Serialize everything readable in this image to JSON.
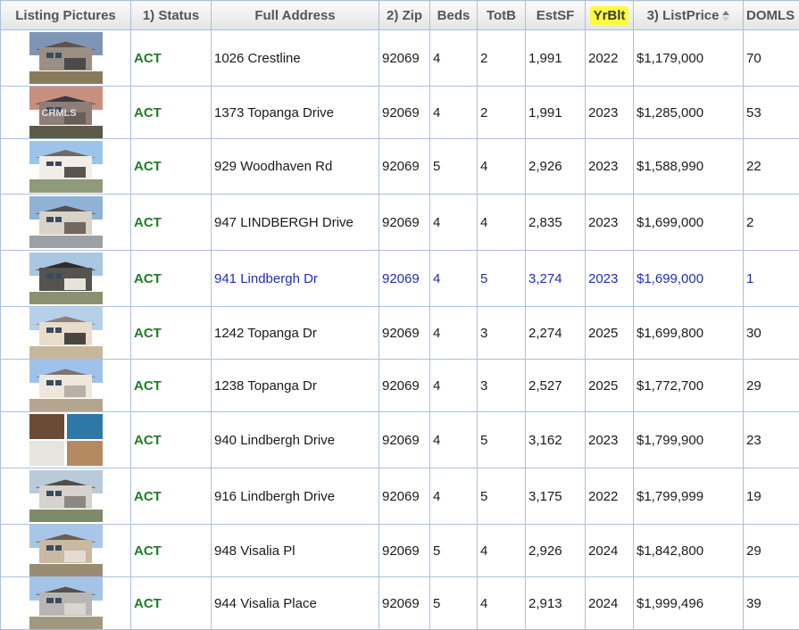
{
  "headers": {
    "pictures": "Listing Pictures",
    "status": "1) Status",
    "address": "Full Address",
    "zip": "2) Zip",
    "beds": "Beds",
    "totb": "TotB",
    "estsf": "EstSF",
    "yrblt": "YrBlt",
    "listprice": "3) ListPrice",
    "doml": "DOMLS"
  },
  "highlight_color": "#fffb3a",
  "status_color": "#1e7d24",
  "selected_row_color": "#1f2fb0",
  "rows": [
    {
      "status": "ACT",
      "address": "1026 Crestline",
      "zip": "92069",
      "beds": "4",
      "totb": "2",
      "estsf": "1,991",
      "yrblt": "2022",
      "price": "$1,179,000",
      "doml": "70",
      "photo": "aerial-neighborhood-photo"
    },
    {
      "status": "ACT",
      "address": "1373  Topanga Drive",
      "zip": "92069",
      "beds": "4",
      "totb": "2",
      "estsf": "1,991",
      "yrblt": "2023",
      "price": "$1,285,000",
      "doml": "53",
      "photo": "dusk-house-photo",
      "watermark": "CRMLS"
    },
    {
      "status": "ACT",
      "address": "929 Woodhaven Rd",
      "zip": "92069",
      "beds": "5",
      "totb": "4",
      "estsf": "2,926",
      "yrblt": "2023",
      "price": "$1,588,990",
      "doml": "22",
      "photo": "white-house-photo"
    },
    {
      "status": "ACT",
      "address": "947  LINDBERGH Drive",
      "zip": "92069",
      "beds": "4",
      "totb": "4",
      "estsf": "2,835",
      "yrblt": "2023",
      "price": "$1,699,000",
      "doml": "2",
      "photo": "house-collage-photo"
    },
    {
      "status": "ACT",
      "address": "941 Lindbergh Dr",
      "zip": "92069",
      "beds": "4",
      "totb": "5",
      "estsf": "3,274",
      "yrblt": "2023",
      "price": "$1,699,000",
      "doml": "1",
      "photo": "dark-siding-house-photo",
      "selected": true
    },
    {
      "status": "ACT",
      "address": "1242 Topanga Dr",
      "zip": "92069",
      "beds": "4",
      "totb": "3",
      "estsf": "2,274",
      "yrblt": "2025",
      "price": "$1,699,800",
      "doml": "30",
      "photo": "beige-house-photo"
    },
    {
      "status": "ACT",
      "address": "1238 Topanga Dr",
      "zip": "92069",
      "beds": "4",
      "totb": "3",
      "estsf": "2,527",
      "yrblt": "2025",
      "price": "$1,772,700",
      "doml": "29",
      "photo": "single-story-house-photo"
    },
    {
      "status": "ACT",
      "address": "940  Lindbergh Drive",
      "zip": "92069",
      "beds": "4",
      "totb": "5",
      "estsf": "3,162",
      "yrblt": "2023",
      "price": "$1,799,900",
      "doml": "23",
      "photo": "interior-collage-photo"
    },
    {
      "status": "ACT",
      "address": "916  Lindbergh Drive",
      "zip": "92069",
      "beds": "4",
      "totb": "5",
      "estsf": "3,175",
      "yrblt": "2022",
      "price": "$1,799,999",
      "doml": "19",
      "photo": "hillside-house-photo"
    },
    {
      "status": "ACT",
      "address": "948 Visalia Pl",
      "zip": "92069",
      "beds": "5",
      "totb": "4",
      "estsf": "2,926",
      "yrblt": "2024",
      "price": "$1,842,800",
      "doml": "29",
      "photo": "two-story-house-photo"
    },
    {
      "status": "ACT",
      "address": "944  Visalia Place",
      "zip": "92069",
      "beds": "5",
      "totb": "4",
      "estsf": "2,913",
      "yrblt": "2024",
      "price": "$1,999,496",
      "doml": "39",
      "photo": "gray-house-photo"
    }
  ]
}
